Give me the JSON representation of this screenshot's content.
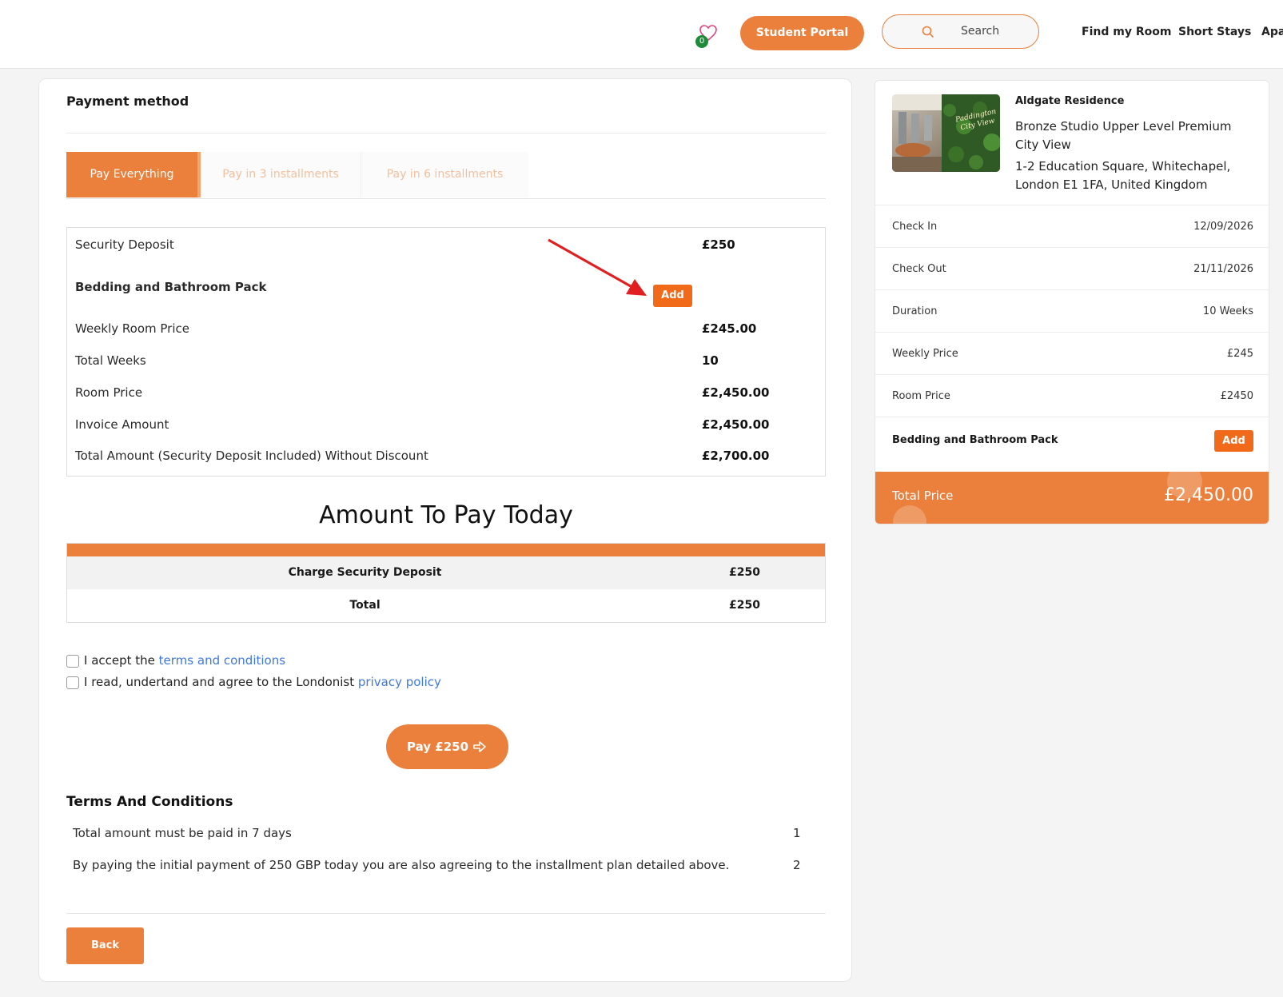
{
  "header": {
    "wishlist_count": "0",
    "student_portal": "Student Portal",
    "search_label": "Search",
    "nav": [
      "Find my Room",
      "Short Stays",
      "Apa"
    ]
  },
  "main": {
    "title": "Payment method",
    "tabs": [
      "Pay Everything",
      "Pay in 3 installments",
      "Pay in 6 installments"
    ],
    "active_tab": "Pay Everything",
    "summary": {
      "security_deposit": {
        "label": "Security Deposit",
        "value": "£250"
      },
      "pack": {
        "label": "Bedding and Bathroom Pack",
        "button": "Add"
      },
      "weekly_room_price": {
        "label": "Weekly Room Price",
        "value": "£245.00"
      },
      "total_weeks": {
        "label": "Total Weeks",
        "value": "10"
      },
      "room_price": {
        "label": "Room Price",
        "value": "£2,450.00"
      },
      "invoice_amount": {
        "label": "Invoice Amount",
        "value": "£2,450.00"
      },
      "total_amount": {
        "label": "Total Amount (Security Deposit Included) Without Discount",
        "value": "£2,700.00"
      }
    },
    "amount_today": {
      "title": "Amount To Pay Today",
      "rows": [
        {
          "label": "Charge Security Deposit",
          "value": "£250"
        },
        {
          "label": "Total",
          "value": "£250"
        }
      ]
    },
    "checkboxes": {
      "terms_prefix": "I accept the ",
      "terms_link": "terms and conditions",
      "privacy_prefix": "I read, undertand and agree to the Londonist ",
      "privacy_link": "privacy policy"
    },
    "pay_button": "Pay £250",
    "terms": {
      "title": "Terms And Conditions",
      "items": [
        {
          "text": "Total amount must be paid in 7 days",
          "num": "1"
        },
        {
          "text": "By paying the initial payment of 250 GBP today you are also agreeing to the installment plan detailed above.",
          "num": "2"
        }
      ]
    },
    "back_button": "Back"
  },
  "side": {
    "residence": "Aldgate Residence",
    "room_type": "Bronze Studio Upper Level Premium City View",
    "address": "1-2 Education Square, Whitechapel, London E1 1FA, United Kingdom",
    "photo_sign": "Paddington City View",
    "rows": [
      {
        "label": "Check In",
        "value": "12/09/2026"
      },
      {
        "label": "Check Out",
        "value": "21/11/2026"
      },
      {
        "label": "Duration",
        "value": "10 Weeks"
      },
      {
        "label": "Weekly Price",
        "value": "£245"
      },
      {
        "label": "Room Price",
        "value": "£2450"
      }
    ],
    "pack_label": "Bedding and Bathroom Pack",
    "pack_button": "Add",
    "total_label": "Total Price",
    "total_value": "£2,450.00"
  },
  "colors": {
    "accent": "#eb7f3c",
    "add_button": "#f06a1a",
    "link": "#3f78e0",
    "arrow": "#e02020"
  }
}
